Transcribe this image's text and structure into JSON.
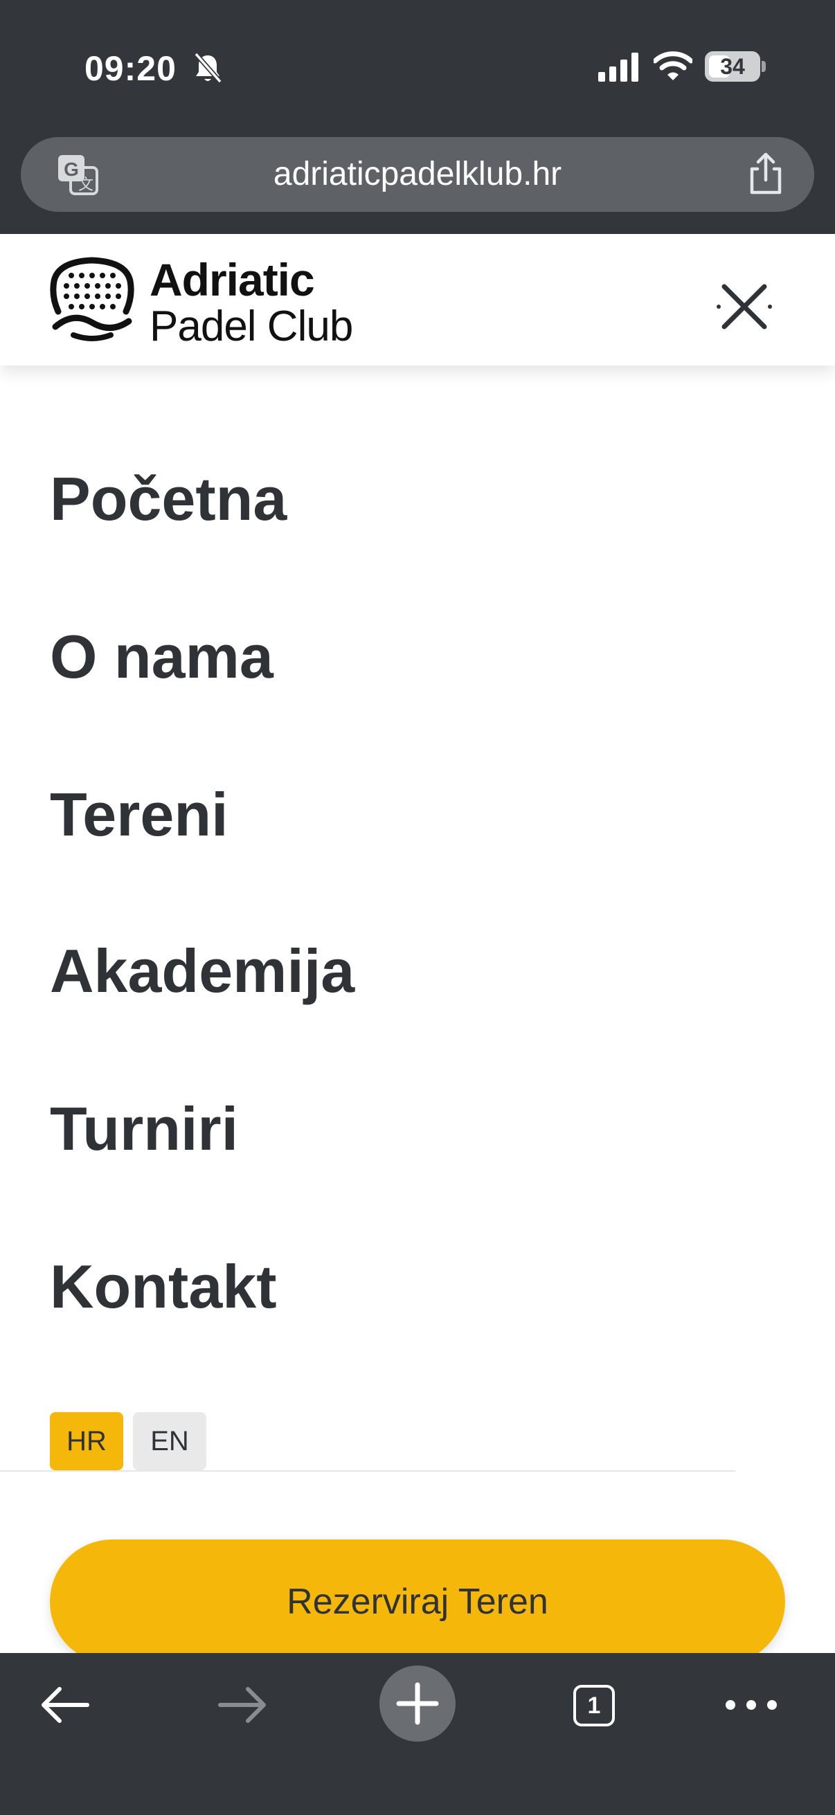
{
  "status_bar": {
    "time": "09:20",
    "battery": "34",
    "icons": [
      "bell-off-icon",
      "signal-icon",
      "wifi-icon",
      "battery-icon"
    ]
  },
  "browser": {
    "url": "adriaticpadelklub.hr",
    "icons": [
      "translate-icon",
      "share-icon"
    ],
    "tab_count": "1",
    "bottom_icons": [
      "back-icon",
      "forward-icon",
      "plus-icon",
      "tabs-icon",
      "more-icon"
    ]
  },
  "header": {
    "logo_line1": "Adriatic",
    "logo_line2_a": "Padel",
    "logo_line2_b": " Club",
    "close_icon": "close-icon"
  },
  "menu": {
    "items": [
      {
        "label": "Početna"
      },
      {
        "label": "O nama"
      },
      {
        "label": "Tereni"
      },
      {
        "label": "Akademija"
      },
      {
        "label": "Turniri"
      },
      {
        "label": "Kontakt"
      }
    ]
  },
  "language": {
    "options": [
      {
        "label": "HR",
        "active": true
      },
      {
        "label": "EN",
        "active": false
      }
    ]
  },
  "cta": {
    "label": "Rezerviraj Teren"
  },
  "colors": {
    "accent": "#f5b80a",
    "text": "#2f3337",
    "chrome": "#33363a",
    "url_bar": "#5e6165"
  }
}
